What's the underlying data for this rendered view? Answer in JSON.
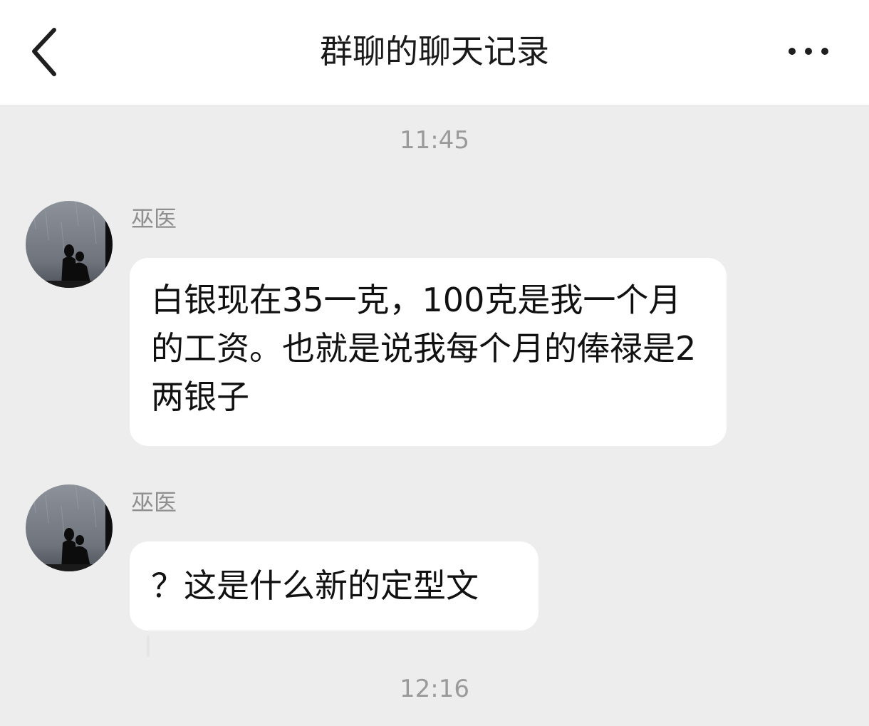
{
  "header": {
    "title": "群聊的聊天记录",
    "back_icon": "chevron-left-icon",
    "more_icon": "more-horizontal-icon"
  },
  "messages": [
    {
      "timestamp": "11:45",
      "sender": "巫医",
      "text": "白银现在35一克，100克是我一个月的工资。也就是说我每个月的俸禄是2两银子"
    },
    {
      "sender": "巫医",
      "text": "？这是什么新的定型文"
    }
  ],
  "trailing_timestamp": "12:16",
  "colors": {
    "background": "#ededed",
    "header": "#ffffff",
    "bubble": "#ffffff",
    "timestamp": "#9a9a9a",
    "sender": "#8f8f8f"
  }
}
